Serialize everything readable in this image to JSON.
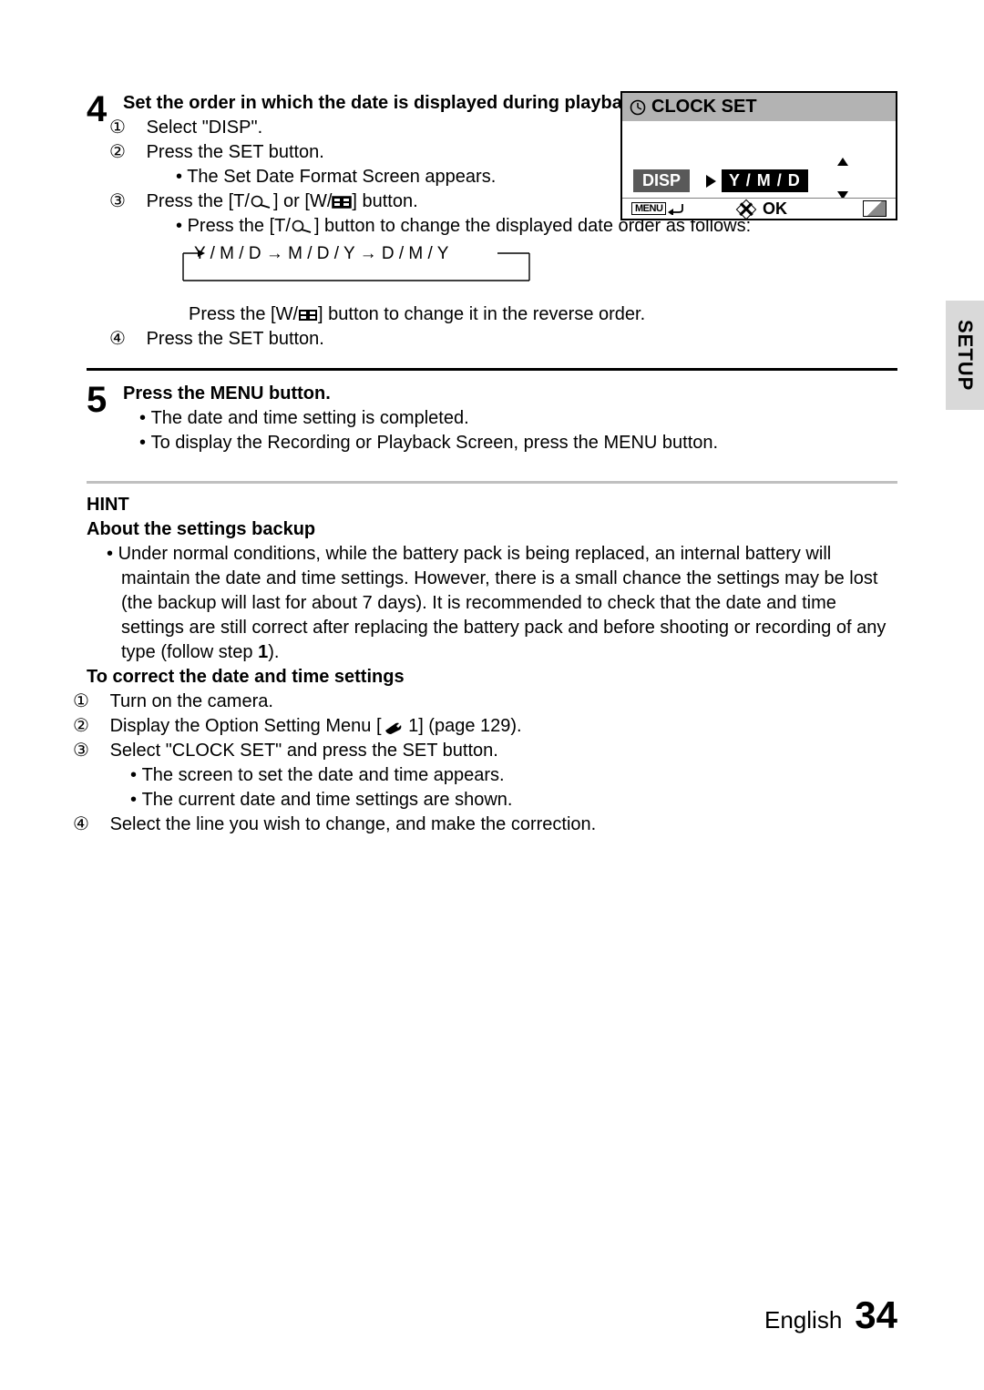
{
  "side_tab": "SETUP",
  "step4": {
    "num": "4",
    "title": "Set the order in which the date is displayed during playback.",
    "s1": "Select \"DISP\".",
    "s2": "Press the SET button.",
    "s2b": "The Set Date Format Screen appears.",
    "s3a": "Press the [T/",
    "s3b": "] or [W/",
    "s3c": "] button.",
    "s3_b1a": "Press the [T/",
    "s3_b1b": "] button to change the displayed date order as follows:",
    "cycle": "Y / M / D → M / D / Y → D / M / Y",
    "reverse_a": "Press the [W/",
    "reverse_b": "] button to change it in the reverse order.",
    "s4": "Press the SET button."
  },
  "screen": {
    "title": "CLOCK SET",
    "disp": "DISP",
    "ymd": "Y / M / D",
    "menu": "MENU",
    "ok": "OK"
  },
  "step5": {
    "num": "5",
    "title": "Press the MENU button.",
    "b1": "The date and time setting is completed.",
    "b2": "To display the Recording or Playback Screen, press the MENU button."
  },
  "hint": {
    "label": "HINT",
    "h1": "About the settings backup",
    "p1_a": "Under normal conditions, while the battery pack is being replaced, an internal battery will maintain the date and time settings. However, there is a small chance the settings may be lost (the backup will last for about 7 days). It is recommended to check that the date and time settings are still correct after replacing the battery pack and before shooting or recording of any type (follow step ",
    "p1_bold": "1",
    "p1_b": ").",
    "h2": "To correct the date and time settings",
    "s1": "Turn on the camera.",
    "s2a": "Display the Option Setting Menu [",
    "s2b": " 1] (page 129).",
    "s3": "Select \"CLOCK SET\" and press the SET button.",
    "s3b1": "The screen to set the date and time appears.",
    "s3b2": "The current date and time settings are shown.",
    "s4": "Select the line you wish to change, and make the correction."
  },
  "footer": {
    "lang": "English",
    "page": "34"
  }
}
